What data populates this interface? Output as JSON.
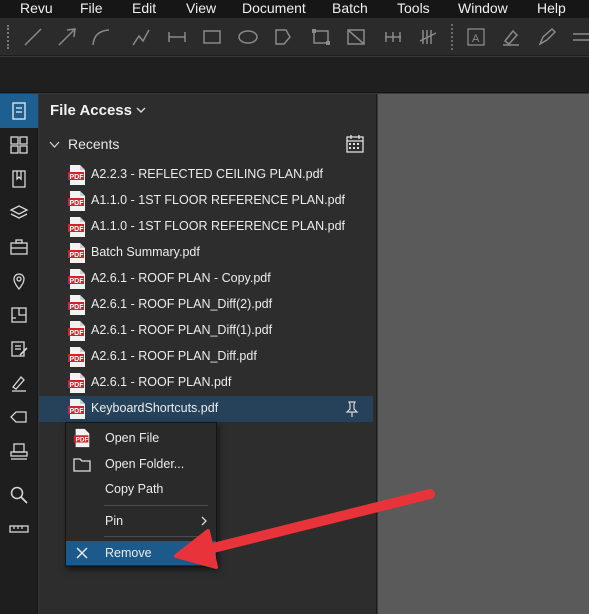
{
  "menu": [
    "Revu",
    "File",
    "Edit",
    "View",
    "Document",
    "Batch",
    "Tools",
    "Window",
    "Help"
  ],
  "toolbar": {
    "tools": [
      "line-icon",
      "arrow-icon",
      "arc-icon",
      "polyline-icon",
      "dimension-icon",
      "rectangle-icon",
      "ellipse-icon",
      "polygon-icon",
      "area-icon",
      "length-icon",
      "segment-icon",
      "count-icon",
      "text-box-icon",
      "highlight-icon",
      "pen-icon"
    ]
  },
  "sidebar_icons": [
    "file-access-icon",
    "thumbnails-icon",
    "bookmarks-icon",
    "layers-icon",
    "tool-chest-icon",
    "places-icon",
    "spaces-icon",
    "markups-list-icon",
    "signatures-icon",
    "tags-icon",
    "stamp-icon",
    "search-icon",
    "measurements-icon"
  ],
  "panel": {
    "title": "File Access",
    "recents_label": "Recents",
    "files": [
      "A2.2.3 - REFLECTED CEILING PLAN.pdf",
      "A1.1.0 - 1ST FLOOR REFERENCE PLAN.pdf",
      "A1.1.0 - 1ST FLOOR REFERENCE PLAN.pdf",
      "Batch Summary.pdf",
      "A2.6.1 - ROOF PLAN - Copy.pdf",
      "A2.6.1 - ROOF PLAN_Diff(2).pdf",
      "A2.6.1 - ROOF PLAN_Diff(1).pdf",
      "A2.6.1 - ROOF PLAN_Diff.pdf",
      "A2.6.1 - ROOF PLAN.pdf",
      "KeyboardShortcuts.pdf"
    ],
    "selected_index": 9,
    "pdf_badge": "PDF"
  },
  "context_menu": {
    "open_file": "Open File",
    "open_folder": "Open Folder...",
    "copy_path": "Copy Path",
    "pin": "Pin",
    "remove": "Remove"
  },
  "colors": {
    "accent": "#1d5f91",
    "annotation_arrow": "#e8333a",
    "pdf_red": "#d3232a"
  }
}
